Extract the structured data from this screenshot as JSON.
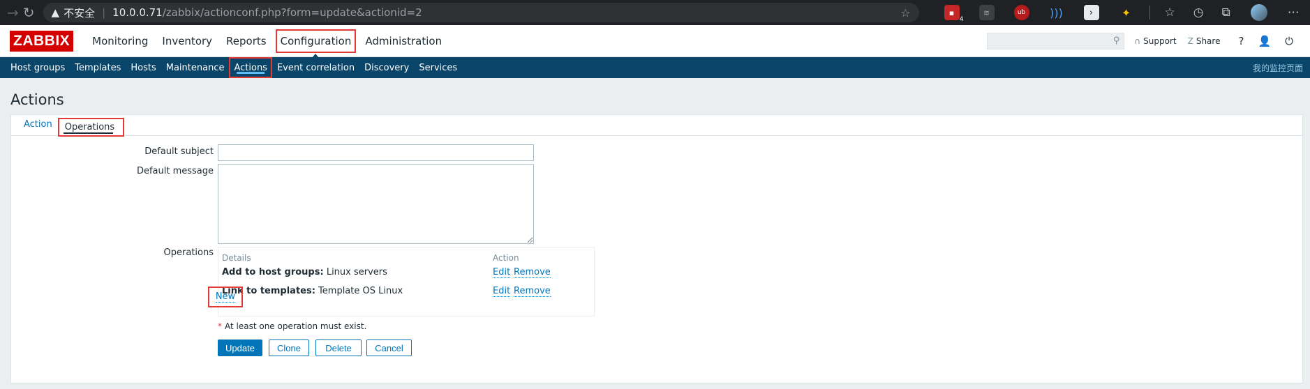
{
  "browser": {
    "insecure_label": "不安全",
    "url_host": "10.0.0.71",
    "url_path": "/zabbix/actionconf.php?form=update&actionid=2",
    "ext_badge": "4",
    "ext_ub": "ub"
  },
  "header": {
    "logo": "ZABBIX",
    "menu": [
      "Monitoring",
      "Inventory",
      "Reports",
      "Configuration",
      "Administration"
    ],
    "support": "Support",
    "share": "Share",
    "help": "?"
  },
  "subnav": {
    "items": [
      "Host groups",
      "Templates",
      "Hosts",
      "Maintenance",
      "Actions",
      "Event correlation",
      "Discovery",
      "Services"
    ],
    "right": "我的监控页面"
  },
  "page": {
    "title": "Actions",
    "tabs": [
      "Action",
      "Operations"
    ]
  },
  "form": {
    "default_subject_label": "Default subject",
    "default_subject_value": "",
    "default_message_label": "Default message",
    "default_message_value": "",
    "operations_label": "Operations",
    "ops_header_details": "Details",
    "ops_header_action": "Action",
    "ops_rows": [
      {
        "bold": "Add to host groups:",
        "text": " Linux servers",
        "edit": "Edit",
        "remove": "Remove"
      },
      {
        "bold": "Link to templates:",
        "text": " Template OS Linux",
        "edit": "Edit",
        "remove": "Remove"
      }
    ],
    "new_link": "New",
    "required_mark": "*",
    "note": "At least one operation must exist.",
    "buttons": {
      "update": "Update",
      "clone": "Clone",
      "delete": "Delete",
      "cancel": "Cancel"
    }
  },
  "colors": {
    "brand_red": "#d40000",
    "nav_blue": "#0a466a",
    "link_blue": "#0275b8",
    "highlight_red": "#e53935"
  }
}
